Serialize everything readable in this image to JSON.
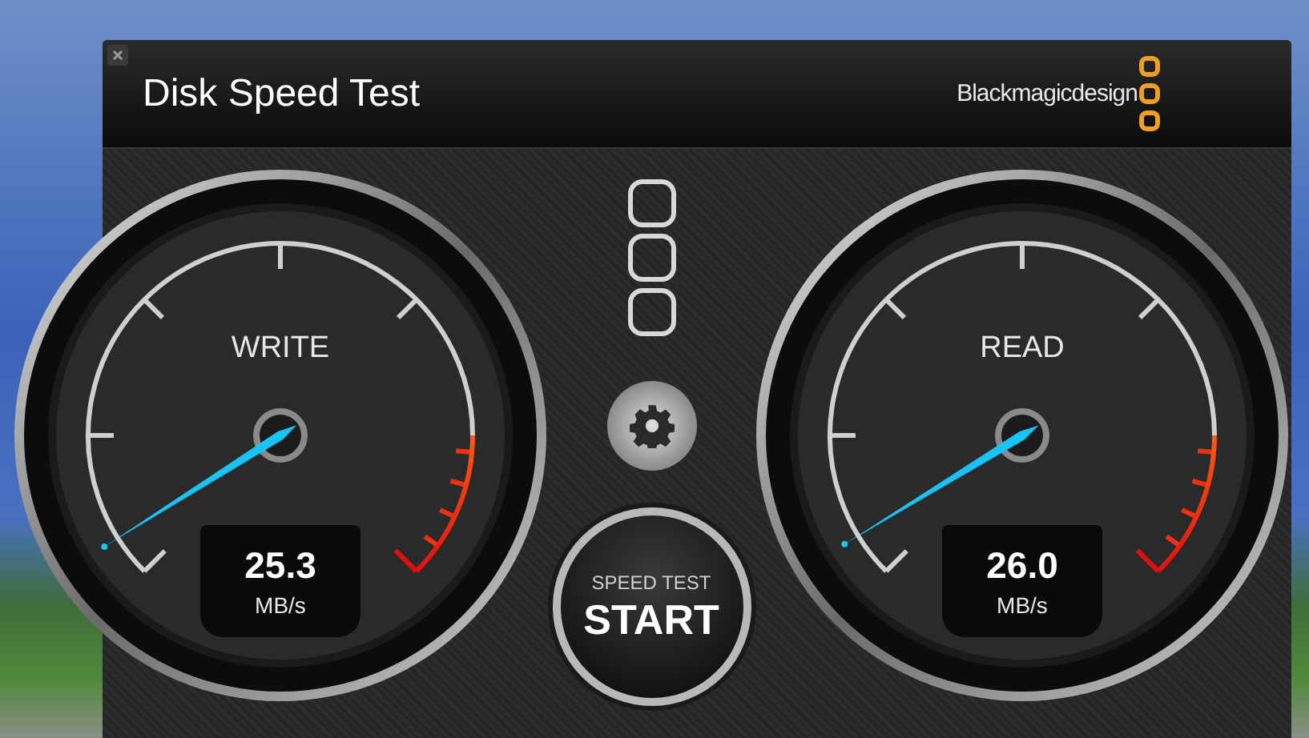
{
  "window": {
    "title": "Disk Speed Test",
    "brand": "Blackmagicdesign"
  },
  "gauges": [
    {
      "label": "WRITE",
      "value": "25.3",
      "unit": "MB/s",
      "level": 0.047
    },
    {
      "label": "READ",
      "value": "26.0",
      "unit": "MB/s",
      "level": 0.05
    }
  ],
  "start_button": {
    "caption": "SPEED TEST",
    "label": "START"
  }
}
